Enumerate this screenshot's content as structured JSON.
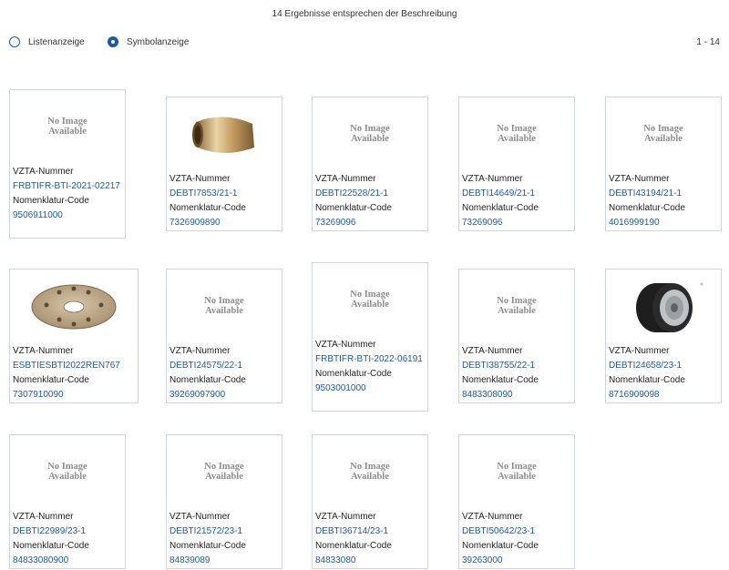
{
  "header": {
    "results_text": "14 Ergebnisse entsprechen der Beschreibung"
  },
  "view_options": {
    "list_label": "Listenanzeige",
    "symbol_label": "Symbolanzeige",
    "selected": "Symbolanzeige",
    "range": "1 - 14"
  },
  "labels": {
    "vzta": "VZTA-Nummer",
    "nomenklatur": "Nomenklatur-Code",
    "no_image_1": "No Image",
    "no_image_2": "Available"
  },
  "colors": {
    "link": "#1d5aa0",
    "border": "#cfd4da"
  },
  "items": [
    {
      "vzta": "FRBTIFR-BTI-2021-02217",
      "code": "9506911000",
      "image": "no-image"
    },
    {
      "vzta": "DEBTI7853/21-1",
      "code": "7326909890",
      "image": "bushing-photo"
    },
    {
      "vzta": "DEBTI22528/21-1",
      "code": "73269096",
      "image": "no-image"
    },
    {
      "vzta": "DEBTI14649/21-1",
      "code": "73269096",
      "image": "no-image"
    },
    {
      "vzta": "DEBTI43194/21-1",
      "code": "4016999190",
      "image": "no-image"
    },
    {
      "vzta": "ESBTIESBTI2022REN767",
      "code": "7307910090",
      "image": "flange-photo"
    },
    {
      "vzta": "DEBTI24575/22-1",
      "code": "39269097900",
      "image": "no-image"
    },
    {
      "vzta": "FRBTIFR-BTI-2022-06191",
      "code": "9503001000",
      "image": "no-image"
    },
    {
      "vzta": "DEBTI38755/22-1",
      "code": "8483308090",
      "image": "no-image"
    },
    {
      "vzta": "DEBTI24658/23-1",
      "code": "8716909098",
      "image": "wheel-photo"
    },
    {
      "vzta": "DEBTI22989/23-1",
      "code": "84833080900",
      "image": "no-image"
    },
    {
      "vzta": "DEBTI21572/23-1",
      "code": "84839089",
      "image": "no-image"
    },
    {
      "vzta": "DEBTI36714/23-1",
      "code": "84833080",
      "image": "no-image"
    },
    {
      "vzta": "DEBTI50642/23-1",
      "code": "39263000",
      "image": "no-image"
    }
  ]
}
